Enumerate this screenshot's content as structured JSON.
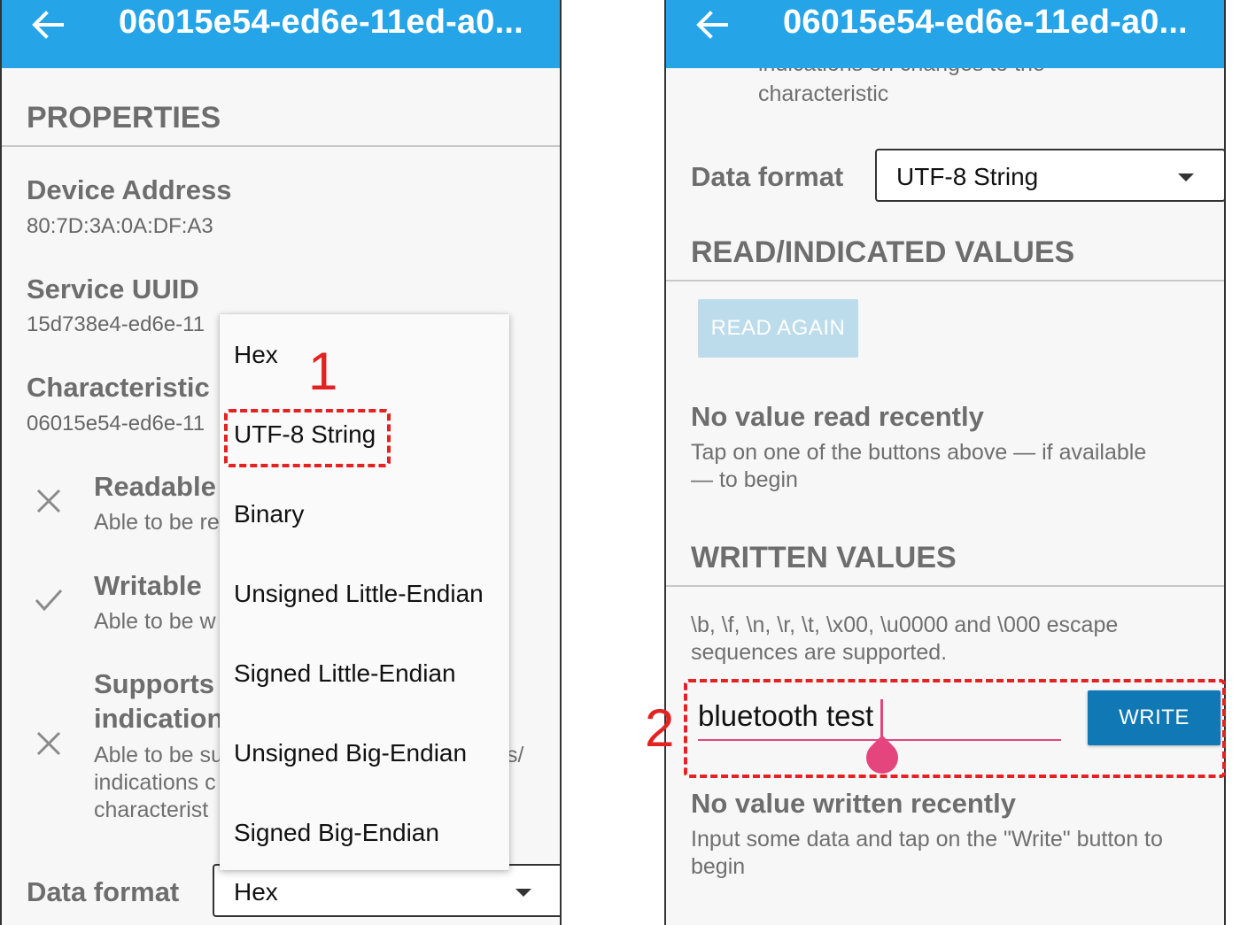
{
  "left_screen": {
    "app_bar": {
      "title": "06015e54-ed6e-11ed-a0..."
    },
    "properties_header": "PROPERTIES",
    "device_address": {
      "label": "Device Address",
      "value": "80:7D:3A:0A:DF:A3"
    },
    "service_uuid": {
      "label": "Service UUID",
      "value": "15d738e4-ed6e-11"
    },
    "characteristic": {
      "label": "Characteristic",
      "value": "06015e54-ed6e-11"
    },
    "readable": {
      "title": "Readable",
      "desc": "Able to be re"
    },
    "writable": {
      "title": "Writable",
      "desc": "Able to be w"
    },
    "supports": {
      "title_line1": "Supports",
      "title_line2": "indication",
      "desc_line1": "Able to be su",
      "desc_line1_tail": "s/",
      "desc_line2": "indications c",
      "desc_line3": "characterist"
    },
    "data_format": {
      "label": "Data format",
      "selected": "Hex"
    },
    "dropdown_options": [
      "Hex",
      "UTF-8 String",
      "Binary",
      "Unsigned Little-Endian",
      "Signed Little-Endian",
      "Unsigned Big-Endian",
      "Signed Big-Endian"
    ],
    "annotation_number": "1"
  },
  "right_screen": {
    "app_bar": {
      "title": "06015e54-ed6e-11ed-a0..."
    },
    "scrolled_text_top": "indications on changes to the",
    "scrolled_text": "characteristic",
    "data_format": {
      "label": "Data format",
      "selected": "UTF-8 String"
    },
    "read_header": "READ/INDICATED VALUES",
    "read_again_button": "READ AGAIN",
    "no_value_read": {
      "title": "No value read recently",
      "line1": "Tap on one of the buttons above — if available",
      "line2": "— to begin"
    },
    "written_header": "WRITTEN VALUES",
    "escape_note": {
      "line1": "\\b, \\f, \\n, \\r, \\t, \\x00, \\u0000 and \\000 escape",
      "line2": "sequences are supported."
    },
    "input_value": "bluetooth test",
    "write_button": "WRITE",
    "no_value_written": {
      "title": "No value written recently",
      "line1": "Input some data and tap on the \"Write\" button to",
      "line2": "begin"
    },
    "annotation_number": "2"
  },
  "colors": {
    "app_bar": "#26a4e8",
    "annotation": "#e32222",
    "write_button": "#1178b6",
    "accent": "#e5457d"
  }
}
